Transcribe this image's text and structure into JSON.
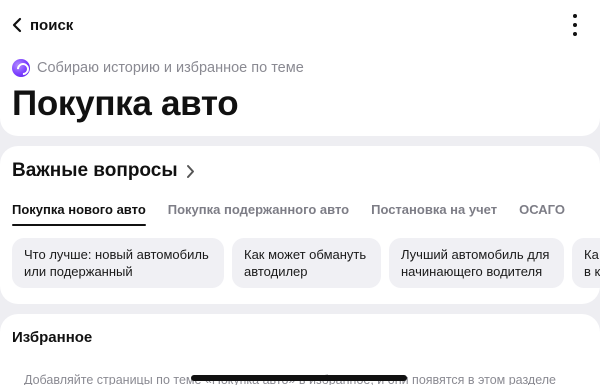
{
  "header": {
    "back_label": "поиск",
    "subtitle": "Собираю историю и избранное по теме",
    "title": "Покупка авто"
  },
  "questions": {
    "title": "Важные вопросы",
    "tabs": [
      {
        "label": "Покупка нового авто",
        "active": true
      },
      {
        "label": "Покупка подержанного авто",
        "active": false
      },
      {
        "label": "Постановка на учет",
        "active": false
      },
      {
        "label": "ОСАГО",
        "active": false
      }
    ],
    "chips": [
      {
        "line1": "Что лучше: новый автомобиль",
        "line2": "или подержанный"
      },
      {
        "line1": "Как может обмануть",
        "line2": "автодилер"
      },
      {
        "line1": "Лучший автомобиль для",
        "line2": "начинающего водителя"
      },
      {
        "line1": "Ка",
        "line2": "в к"
      }
    ]
  },
  "favorites": {
    "title": "Избранное",
    "hint": "Добавляйте страницы по теме «Покупка авто» в избранное, и они появятся в этом разделе"
  },
  "colors": {
    "background": "#eeeef2",
    "card": "#ffffff",
    "chip": "#f0f0f4",
    "muted_text": "#8a8a92",
    "accent_alice": "#7a3dff"
  }
}
